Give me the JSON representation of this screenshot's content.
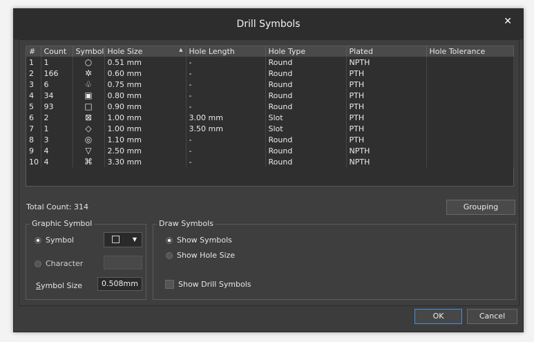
{
  "window": {
    "title": "Drill Symbols"
  },
  "table": {
    "columns": [
      "#",
      "Count",
      "Symbol",
      "Hole Size",
      "Hole Length",
      "Hole Type",
      "Plated",
      "Hole Tolerance"
    ],
    "sort_indicator": "▲",
    "rows": [
      {
        "n": "1",
        "count": "1",
        "symbol": "○",
        "size": "0.51 mm",
        "length": "-",
        "type": "Round",
        "plated": "NPTH",
        "tol": ""
      },
      {
        "n": "2",
        "count": "166",
        "symbol": "✲",
        "size": "0.60 mm",
        "length": "-",
        "type": "Round",
        "plated": "PTH",
        "tol": ""
      },
      {
        "n": "3",
        "count": "6",
        "symbol": "♧",
        "size": "0.75 mm",
        "length": "-",
        "type": "Round",
        "plated": "PTH",
        "tol": ""
      },
      {
        "n": "4",
        "count": "34",
        "symbol": "▣",
        "size": "0.80 mm",
        "length": "-",
        "type": "Round",
        "plated": "PTH",
        "tol": ""
      },
      {
        "n": "5",
        "count": "93",
        "symbol": "□",
        "size": "0.90 mm",
        "length": "-",
        "type": "Round",
        "plated": "PTH",
        "tol": ""
      },
      {
        "n": "6",
        "count": "2",
        "symbol": "⊠",
        "size": "1.00 mm",
        "length": "3.00 mm",
        "type": "Slot",
        "plated": "PTH",
        "tol": ""
      },
      {
        "n": "7",
        "count": "1",
        "symbol": "◇",
        "size": "1.00 mm",
        "length": "3.50 mm",
        "type": "Slot",
        "plated": "PTH",
        "tol": ""
      },
      {
        "n": "8",
        "count": "3",
        "symbol": "◎",
        "size": "1.10 mm",
        "length": "-",
        "type": "Round",
        "plated": "PTH",
        "tol": ""
      },
      {
        "n": "9",
        "count": "4",
        "symbol": "▽",
        "size": "2.50 mm",
        "length": "-",
        "type": "Round",
        "plated": "NPTH",
        "tol": ""
      },
      {
        "n": "10",
        "count": "4",
        "symbol": "⌘",
        "size": "3.30 mm",
        "length": "-",
        "type": "Round",
        "plated": "NPTH",
        "tol": ""
      }
    ]
  },
  "total_count": "Total Count: 314",
  "grouping_label": "Grouping",
  "graphic_symbol": {
    "legend": "Graphic Symbol",
    "symbol_label": "Symbol",
    "symbol_value": "□",
    "character_label": "Character",
    "size_label": "Symbol Size",
    "size_label_mnemonic": "S",
    "size_value": "0.508mm"
  },
  "draw_symbols": {
    "legend": "Draw Symbols",
    "show_symbols": "Show Symbols",
    "show_hole_size": "Show Hole Size",
    "show_drill_symbols": "Show Drill Symbols"
  },
  "footer": {
    "ok": "OK",
    "cancel": "Cancel"
  },
  "colors": {
    "accent": "#4a90d9",
    "window_bg": "#3c3c3c",
    "title_bg": "#2d2d2d"
  }
}
